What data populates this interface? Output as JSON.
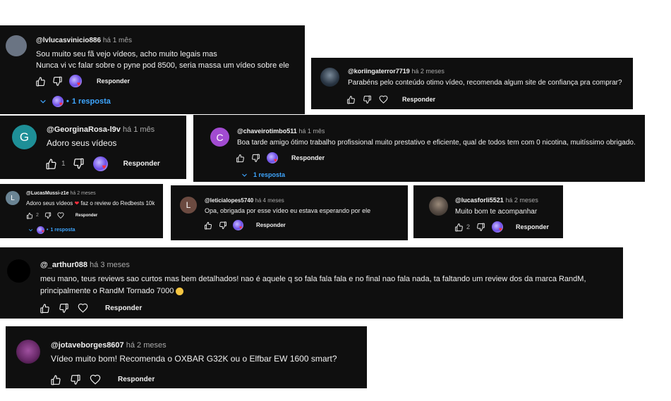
{
  "labels": {
    "reply": "Responder"
  },
  "colors": {
    "card_bg": "#0f0f0f",
    "link_blue": "#3ea6ff",
    "time_gray": "#aaaaaa",
    "heart_red": "#ff2d3c"
  },
  "icons": {
    "like": "thumb-up-icon",
    "dislike": "thumb-down-icon",
    "heart": "heart-icon",
    "expand": "chevron-down-icon"
  },
  "comments": [
    {
      "username": "@lvlucasvinicio886",
      "time": "há 1 mês",
      "lines": [
        "Sou muito seu  fã vejo vídeos, acho muito legais mas",
        "Nunca vi vc falar sobre o pyne pod 8500, seria massa um vídeo sobre ele"
      ],
      "replies": "1 resposta",
      "avatar_color": "#6a7483"
    },
    {
      "username": "@koriingaterror7719",
      "time": "há 2 meses",
      "lines": [
        "Parabéns pelo conteúdo otimo vídeo, recomenda algum site de confiança pra comprar?"
      ],
      "avatar_color": "#3a4a5a"
    },
    {
      "username": "@GeorginaRosa-l9v",
      "time": "há 1 mês",
      "lines": [
        "Adoro seus vídeos"
      ],
      "likes": "1",
      "avatar_letter": "G",
      "avatar_color": "#1e8f97"
    },
    {
      "username": "@chaveirotimbo511",
      "time": "há 1 mês",
      "lines": [
        "Boa tarde amigo ótimo  trabalho profissional muito prestativo e eficiente,   qual de todos tem com 0 nicotina, muitíssimo obrigado."
      ],
      "replies": "1 resposta",
      "avatar_letter": "C",
      "avatar_color": "#a24bd1"
    },
    {
      "username": "@LucasMussi-z1e",
      "time": "há 2 meses",
      "lines": [
        "Adoro seus vídeos",
        "faz o review do Redbests 10k"
      ],
      "likes": "2",
      "replies": "1 resposta",
      "avatar_letter": "L",
      "avatar_color": "#6a8494"
    },
    {
      "username": "@leticialopes5740",
      "time": "há 4 meses",
      "lines": [
        "Opa, obrigada por esse vídeo eu estava esperando por ele"
      ],
      "avatar_letter": "L",
      "avatar_color": "#6b4a40"
    },
    {
      "username": "@lucasforli5521",
      "time": "há 2 meses",
      "lines": [
        "Muito bom te acompanhar"
      ],
      "likes": "2",
      "avatar_color": "#5b5048"
    },
    {
      "username": "@_arthur088",
      "time": "há 3 meses",
      "lines": [
        "meu mano, teus reviews sao curtos mas bem detalhados! nao é aquele q so fala fala fala e no final nao fala nada, ta faltando um review dos da marca RandM,",
        "principalmente o RandM Tornado 7000"
      ],
      "avatar_color": "#000000"
    },
    {
      "username": "@jotaveborges8607",
      "time": "há 2 meses",
      "lines": [
        "Vídeo muito bom! Recomenda o OXBAR G32K ou o Elfbar EW 1600 smart?"
      ],
      "avatar_color": "#6a2a6a"
    }
  ]
}
